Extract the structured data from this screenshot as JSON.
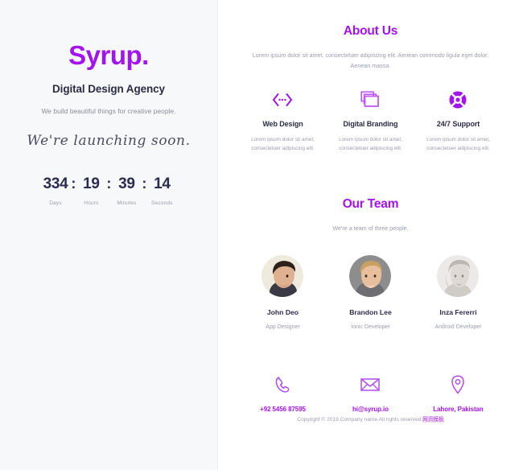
{
  "brand": {
    "logo": "Syrup.",
    "tagline": "Digital Design Agency",
    "description": "We build beautiful things for creative people.",
    "launch_text": "We're launching soon.",
    "accent_color": "#a312f0",
    "dark_color": "#2b2b45"
  },
  "countdown": {
    "separator": ":",
    "units": [
      {
        "value": "334",
        "label": "Days"
      },
      {
        "value": "19",
        "label": "Hours"
      },
      {
        "value": "39",
        "label": "Minutes"
      },
      {
        "value": "14",
        "label": "Seconds"
      }
    ]
  },
  "about": {
    "title": "About Us",
    "subtitle": "Lorem ipsum dolor sit amet, consectetuer adipiscing elit. Aenean commodo ligula eget dolor. Aenean massa.",
    "services": [
      {
        "icon": "code-brackets-icon",
        "title": "Web Design",
        "description": "Lorem ipsum dolor sit amet, consectetuer adipiscing elit."
      },
      {
        "icon": "layers-icon",
        "title": "Digital Branding",
        "description": "Lorem ipsum dolor sit amet, consectetuer adipiscing elit."
      },
      {
        "icon": "lifebuoy-icon",
        "title": "24/7 Support",
        "description": "Lorem ipsum dolor sit amet, consectetuer adipiscing elit."
      }
    ]
  },
  "team": {
    "title": "Our Team",
    "subtitle": "We're a team of three people.",
    "members": [
      {
        "name": "John Deo",
        "role": "App Designer",
        "avatar": "avatar-photo-male-dark-hair"
      },
      {
        "name": "Brandon Lee",
        "role": "Ionic Developer",
        "avatar": "avatar-photo-male-blond"
      },
      {
        "name": "Inza Fererri",
        "role": "Android Developer",
        "avatar": "avatar-photo-female"
      }
    ]
  },
  "contact": {
    "items": [
      {
        "icon": "phone-icon",
        "value": "+92 5456 87595"
      },
      {
        "icon": "envelope-icon",
        "value": "hi@syrup.io"
      },
      {
        "icon": "location-pin-icon",
        "value": "Lahore, Pakistan"
      }
    ]
  },
  "footer": {
    "text": "Copyright © 2019.Company name All rights reserved.",
    "mark": "网页模板"
  }
}
